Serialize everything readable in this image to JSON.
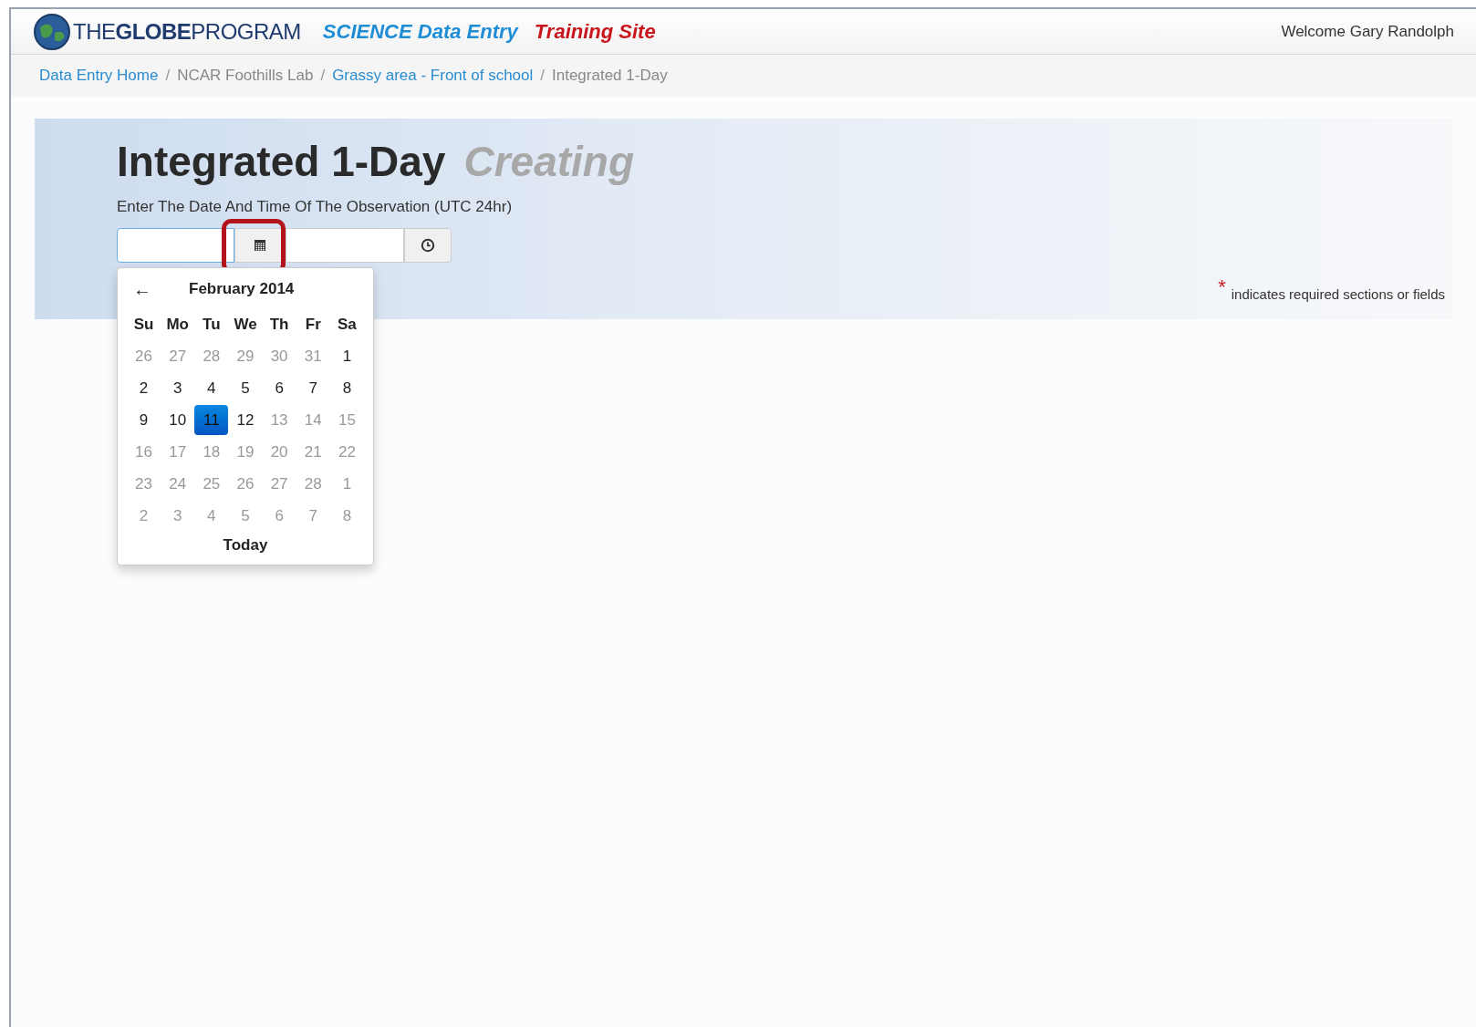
{
  "header": {
    "logo_text": "THE**GLOBE**PROGRAM",
    "app_title": "SCIENCE Data Entry",
    "site_label": "Training Site",
    "welcome": "Welcome Gary Randolph"
  },
  "breadcrumb_separator": "/",
  "breadcrumb": [
    {
      "label": "Data Entry Home",
      "link": true
    },
    {
      "label": "NCAR Foothills Lab",
      "link": false
    },
    {
      "label": "Grassy area - Front of school",
      "link": true
    },
    {
      "label": "Integrated 1-Day",
      "link": false
    }
  ],
  "page": {
    "title": "Integrated 1-Day",
    "status": "Creating",
    "prompt": "Enter The Date And Time Of The Observation (UTC 24hr)",
    "required_mark": "*",
    "required_note": "indicates required sections or fields"
  },
  "datepicker": {
    "prev": "←",
    "month": "February 2014",
    "weekdays": [
      "Su",
      "Mo",
      "Tu",
      "We",
      "Th",
      "Fr",
      "Sa"
    ],
    "weeks": [
      [
        {
          "label": "26",
          "muted": true,
          "selected": false
        },
        {
          "label": "27",
          "muted": true,
          "selected": false
        },
        {
          "label": "28",
          "muted": true,
          "selected": false
        },
        {
          "label": "29",
          "muted": true,
          "selected": false
        },
        {
          "label": "30",
          "muted": true,
          "selected": false
        },
        {
          "label": "31",
          "muted": true,
          "selected": false
        },
        {
          "label": "1",
          "muted": false,
          "selected": false
        }
      ],
      [
        {
          "label": "2",
          "muted": false,
          "selected": false
        },
        {
          "label": "3",
          "muted": false,
          "selected": false
        },
        {
          "label": "4",
          "muted": false,
          "selected": false
        },
        {
          "label": "5",
          "muted": false,
          "selected": false
        },
        {
          "label": "6",
          "muted": false,
          "selected": false
        },
        {
          "label": "7",
          "muted": false,
          "selected": false
        },
        {
          "label": "8",
          "muted": false,
          "selected": false
        }
      ],
      [
        {
          "label": "9",
          "muted": false,
          "selected": false
        },
        {
          "label": "10",
          "muted": false,
          "selected": false
        },
        {
          "label": "11",
          "muted": false,
          "selected": true
        },
        {
          "label": "12",
          "muted": false,
          "selected": false
        },
        {
          "label": "13",
          "muted": true,
          "selected": false
        },
        {
          "label": "14",
          "muted": true,
          "selected": false
        },
        {
          "label": "15",
          "muted": true,
          "selected": false
        }
      ],
      [
        {
          "label": "16",
          "muted": true,
          "selected": false
        },
        {
          "label": "17",
          "muted": true,
          "selected": false
        },
        {
          "label": "18",
          "muted": true,
          "selected": false
        },
        {
          "label": "19",
          "muted": true,
          "selected": false
        },
        {
          "label": "20",
          "muted": true,
          "selected": false
        },
        {
          "label": "21",
          "muted": true,
          "selected": false
        },
        {
          "label": "22",
          "muted": true,
          "selected": false
        }
      ],
      [
        {
          "label": "23",
          "muted": true,
          "selected": false
        },
        {
          "label": "24",
          "muted": true,
          "selected": false
        },
        {
          "label": "25",
          "muted": true,
          "selected": false
        },
        {
          "label": "26",
          "muted": true,
          "selected": false
        },
        {
          "label": "27",
          "muted": true,
          "selected": false
        },
        {
          "label": "28",
          "muted": true,
          "selected": false
        },
        {
          "label": "1",
          "muted": true,
          "selected": false
        }
      ],
      [
        {
          "label": "2",
          "muted": true,
          "selected": false
        },
        {
          "label": "3",
          "muted": true,
          "selected": false
        },
        {
          "label": "4",
          "muted": true,
          "selected": false
        },
        {
          "label": "5",
          "muted": true,
          "selected": false
        },
        {
          "label": "6",
          "muted": true,
          "selected": false
        },
        {
          "label": "7",
          "muted": true,
          "selected": false
        },
        {
          "label": "8",
          "muted": true,
          "selected": false
        }
      ]
    ],
    "today": "Today"
  }
}
